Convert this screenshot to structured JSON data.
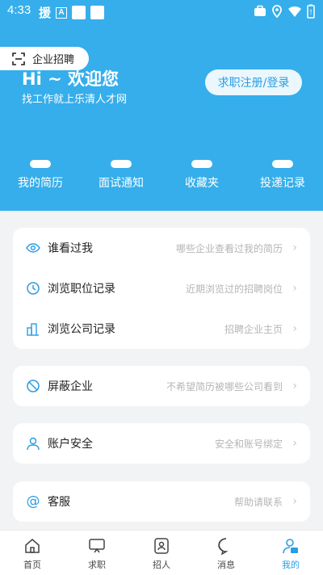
{
  "status_bar": {
    "time": "4:33",
    "app_icon": "援",
    "badge": "A",
    "icons": [
      "briefcase-icon",
      "location-icon",
      "wifi-icon",
      "battery-icon"
    ]
  },
  "header": {
    "company_pill": "企业招聘",
    "greeting": "Hi ~ 欢迎您",
    "subtitle": "找工作就上乐清人才网",
    "login_button": "求职注册/登录",
    "stats": [
      {
        "label": "我的简历"
      },
      {
        "label": "面试通知"
      },
      {
        "label": "收藏夹"
      },
      {
        "label": "投递记录"
      }
    ]
  },
  "menu": {
    "group1": [
      {
        "label": "谁看过我",
        "desc": "哪些企业查看过我的简历",
        "icon": "eye-icon"
      },
      {
        "label": "浏览职位记录",
        "desc": "近期浏览过的招聘岗位",
        "icon": "clock-icon"
      },
      {
        "label": "浏览公司记录",
        "desc": "招聘企业主页",
        "icon": "building-icon"
      }
    ],
    "group2": [
      {
        "label": "屏蔽企业",
        "desc": "不希望简历被哪些公司看到",
        "icon": "block-icon"
      }
    ],
    "group3": [
      {
        "label": "账户安全",
        "desc": "安全和账号绑定",
        "icon": "user-icon"
      }
    ],
    "group4": [
      {
        "label": "客服",
        "desc": "帮助请联系",
        "icon": "at-icon"
      }
    ]
  },
  "tabbar": {
    "tabs": [
      {
        "label": "首页",
        "icon": "home-icon"
      },
      {
        "label": "求职",
        "icon": "monitor-icon"
      },
      {
        "label": "招人",
        "icon": "person-card-icon"
      },
      {
        "label": "消息",
        "icon": "chat-icon"
      },
      {
        "label": "我的",
        "icon": "profile-icon",
        "active": true
      }
    ]
  },
  "colors": {
    "primary": "#35aeeb",
    "accent": "#2a9de3",
    "muted": "#b5b5b5"
  }
}
